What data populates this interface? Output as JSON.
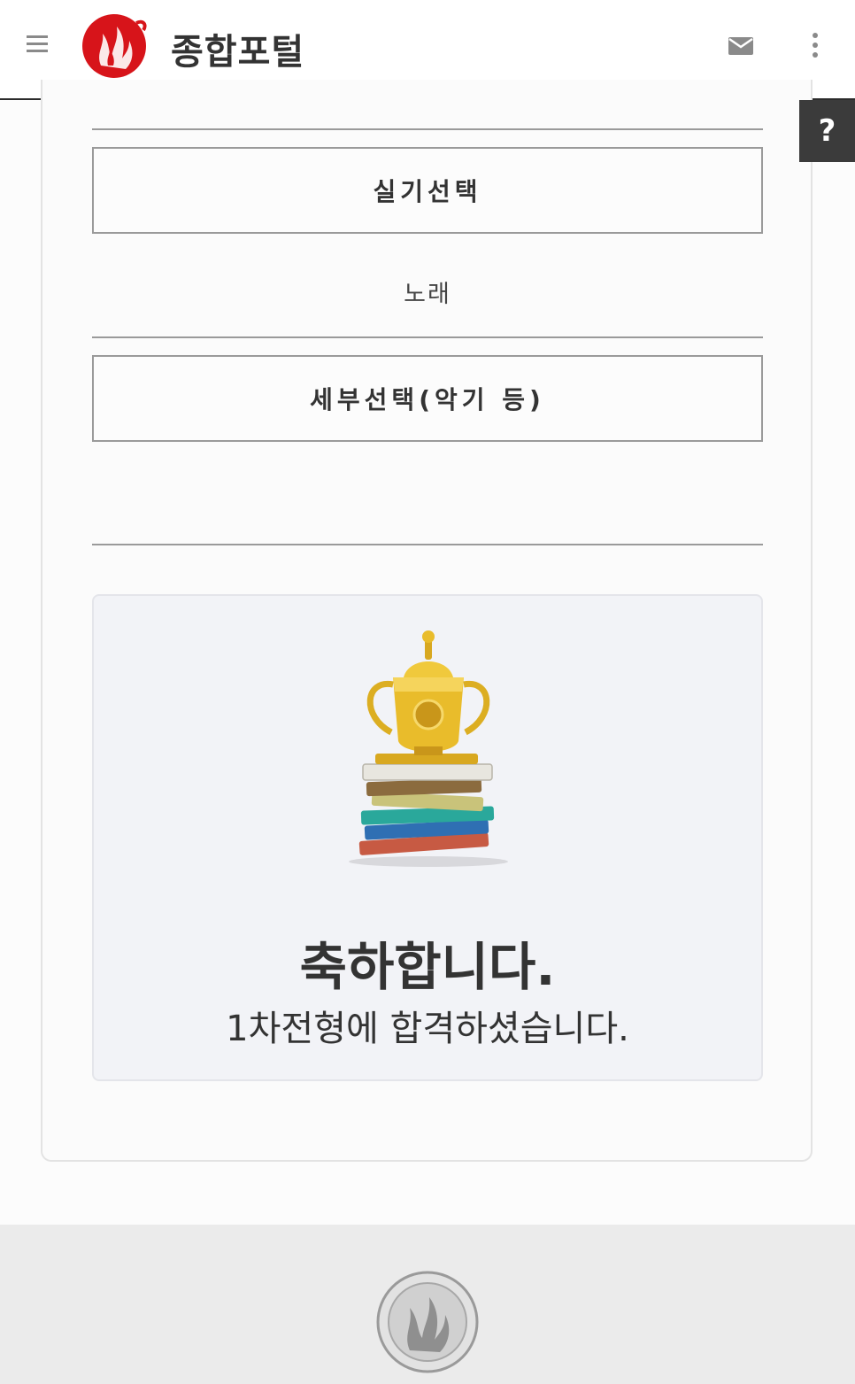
{
  "header": {
    "title": "종합포털",
    "menu_icon": "hamburger-icon",
    "logo_icon": "flame-logo-icon",
    "mail_icon": "mail-icon",
    "more_icon": "more-vertical-icon",
    "brand_color": "#d7141a"
  },
  "help": {
    "label": "?"
  },
  "form": {
    "practical_selection": {
      "label": "실기선택",
      "value": "노래"
    },
    "detail_selection": {
      "label": "세부선택(악기 등)",
      "value": ""
    }
  },
  "result": {
    "image": "trophy-on-books-image",
    "title": "축하합니다.",
    "message": "1차전형에 합격하셨습니다."
  },
  "footer": {
    "seal_icon": "school-seal-icon"
  }
}
